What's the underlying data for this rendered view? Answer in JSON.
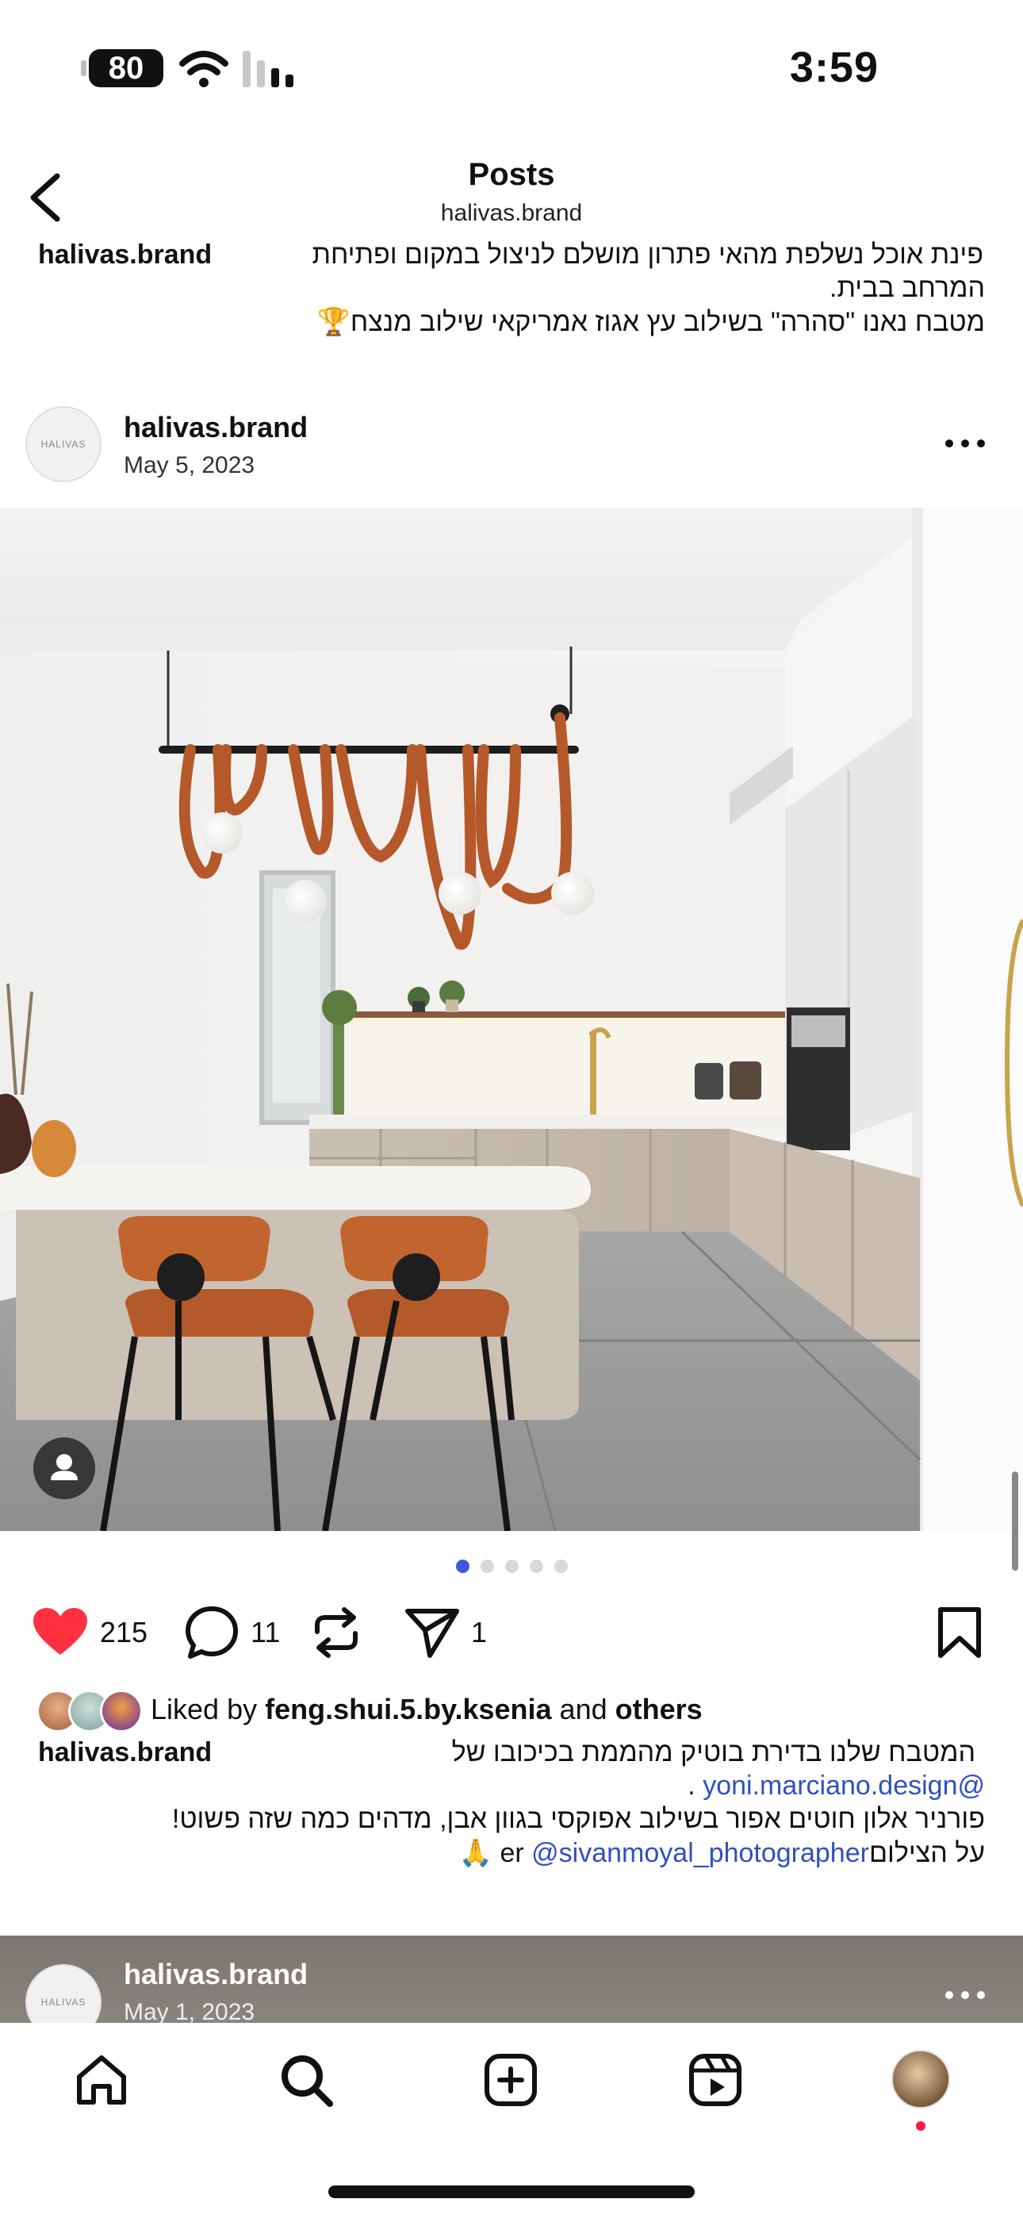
{
  "status_bar": {
    "battery": "80",
    "time": "3:59"
  },
  "nav": {
    "title": "Posts",
    "subtitle": "halivas.brand"
  },
  "prev_caption": {
    "username": "halivas.brand",
    "line1": "פינת אוכל נשלפת מהאי פתרון מושלם לניצול במקום ופתיחת",
    "line2": "המרחב בבית.",
    "line3": "מטבח נאנו \"סהרה\" בשילוב עץ אגוז אמריקאי שילוב מנצח🏆"
  },
  "post": {
    "username": "halivas.brand",
    "date": "May 5, 2023",
    "avatar_text": "HALIVAS",
    "carousel_count": 5,
    "carousel_active": 0,
    "likes_count": "215",
    "comments_count": "11",
    "shares_count": "1",
    "liked_by_prefix": "Liked by ",
    "liked_by_user": "feng.shui.5.by.ksenia",
    "liked_by_and": " and ",
    "liked_by_others": "others",
    "caption_username": "halivas.brand",
    "caption_line1": "המטבח שלנו בדירת בוטיק מהממת בכיכובו של",
    "caption_line2_mention": "@yoni.marciano.design",
    "caption_line2_suffix": " .",
    "caption_line3": "פורניר אלון חוטים אפור בשילוב אפוקסי בגוון אבן, מדהים כמה שזה פשוט!",
    "caption_line4_prefix": "על הצילום",
    "caption_line4_mention": "@sivanmoyal_photographer",
    "caption_line4_mention_suffix": "er",
    "caption_line4_emoji": "🙏"
  },
  "next_post": {
    "username": "halivas.brand",
    "date": "May 1, 2023"
  },
  "tab_bar": {
    "items": [
      "home-icon",
      "search-icon",
      "create-icon",
      "reels-icon",
      "profile-avatar"
    ]
  },
  "colors": {
    "like_red": "#ff3040",
    "link_blue": "#3050c0",
    "dot_active": "#3b5bdb"
  }
}
